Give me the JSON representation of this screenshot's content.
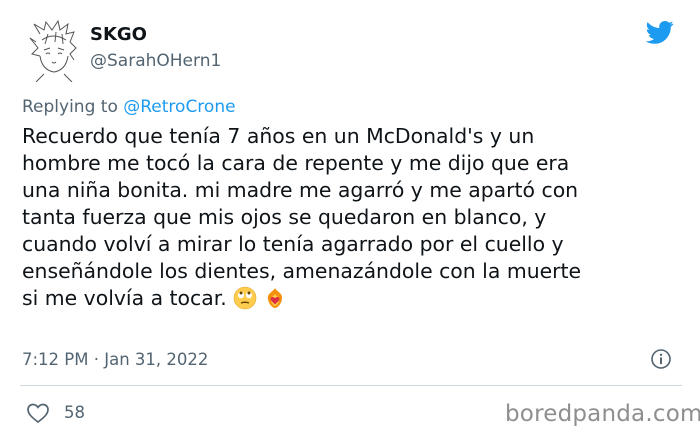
{
  "user": {
    "name": "SKGO",
    "handle": "@SarahOHern1"
  },
  "reply": {
    "prefix": "Replying to",
    "mention": "@RetroCrone"
  },
  "tweet": {
    "text": "Recuerdo que tenía 7 años en un McDonald's y un\nhombre me tocó la cara de repente y me dijo que era\nuna niña bonita. mi madre me agarró y me apartó con\ntanta fuerza que mis ojos se quedaron en blanco, y\ncuando volví a mirar lo tenía agarrado por el cuello y\nenseñándole los dientes, amenazándole con la muerte\nsi me volvía a tocar.",
    "emojis": [
      "eye-roll-emoji",
      "heart-on-fire-emoji"
    ],
    "timestamp": "7:12 PM · Jan 31, 2022"
  },
  "actions": {
    "likes": "58"
  },
  "watermark": "boredpanda.com",
  "colors": {
    "accent": "#1d9bf0",
    "secondary_text": "#536471",
    "text": "#0f1419"
  }
}
